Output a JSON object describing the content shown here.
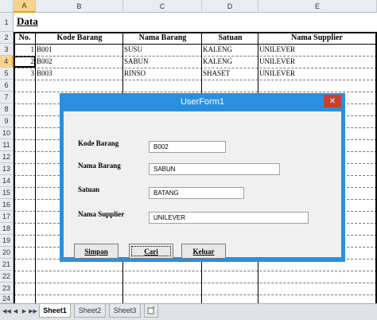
{
  "columns": [
    "A",
    "B",
    "C",
    "D",
    "E"
  ],
  "rows": [
    "1",
    "2",
    "3",
    "4",
    "5",
    "6",
    "7",
    "8",
    "9",
    "10",
    "11",
    "12",
    "13",
    "14",
    "15",
    "16",
    "17",
    "18",
    "19",
    "20",
    "21",
    "22",
    "23",
    "24"
  ],
  "sheet_title": "Data",
  "table": {
    "headers": [
      "No.",
      "Kode Barang",
      "Nama Barang",
      "Satuan",
      "Nama Supplier"
    ],
    "rows": [
      {
        "no": "1",
        "kode": "B001",
        "nama": "SUSU",
        "satuan": "KALENG",
        "supplier": "UNILEVER"
      },
      {
        "no": "2",
        "kode": "B002",
        "nama": "SABUN",
        "satuan": "KALENG",
        "supplier": "UNILEVER"
      },
      {
        "no": "3",
        "kode": "B003",
        "nama": "RINSO",
        "satuan": "SHASET",
        "supplier": "UNILEVER"
      }
    ]
  },
  "dialog": {
    "title": "UserForm1",
    "close_glyph": "✕",
    "fields": {
      "kode_label": "Kode Barang",
      "kode_value": "B002",
      "nama_label": "Nama Barang",
      "nama_value": "SABUN",
      "satuan_label": "Satuan",
      "satuan_value": "BATANG",
      "supplier_label": "Nama Supplier",
      "supplier_value": "UNILEVER"
    },
    "buttons": {
      "simpan": "Simpan",
      "cari": "Cari",
      "keluar": "Keluar"
    }
  },
  "tabs": {
    "nav": [
      "◀◀",
      "◀",
      "▶",
      "▶▶"
    ],
    "sheets": [
      "Sheet1",
      "Sheet2",
      "Sheet3"
    ],
    "new_sheet_icon": "insert-sheet-icon"
  },
  "colors": {
    "accent": "#2b8fde",
    "close": "#c84031",
    "selected_header": "#f7d48b"
  }
}
